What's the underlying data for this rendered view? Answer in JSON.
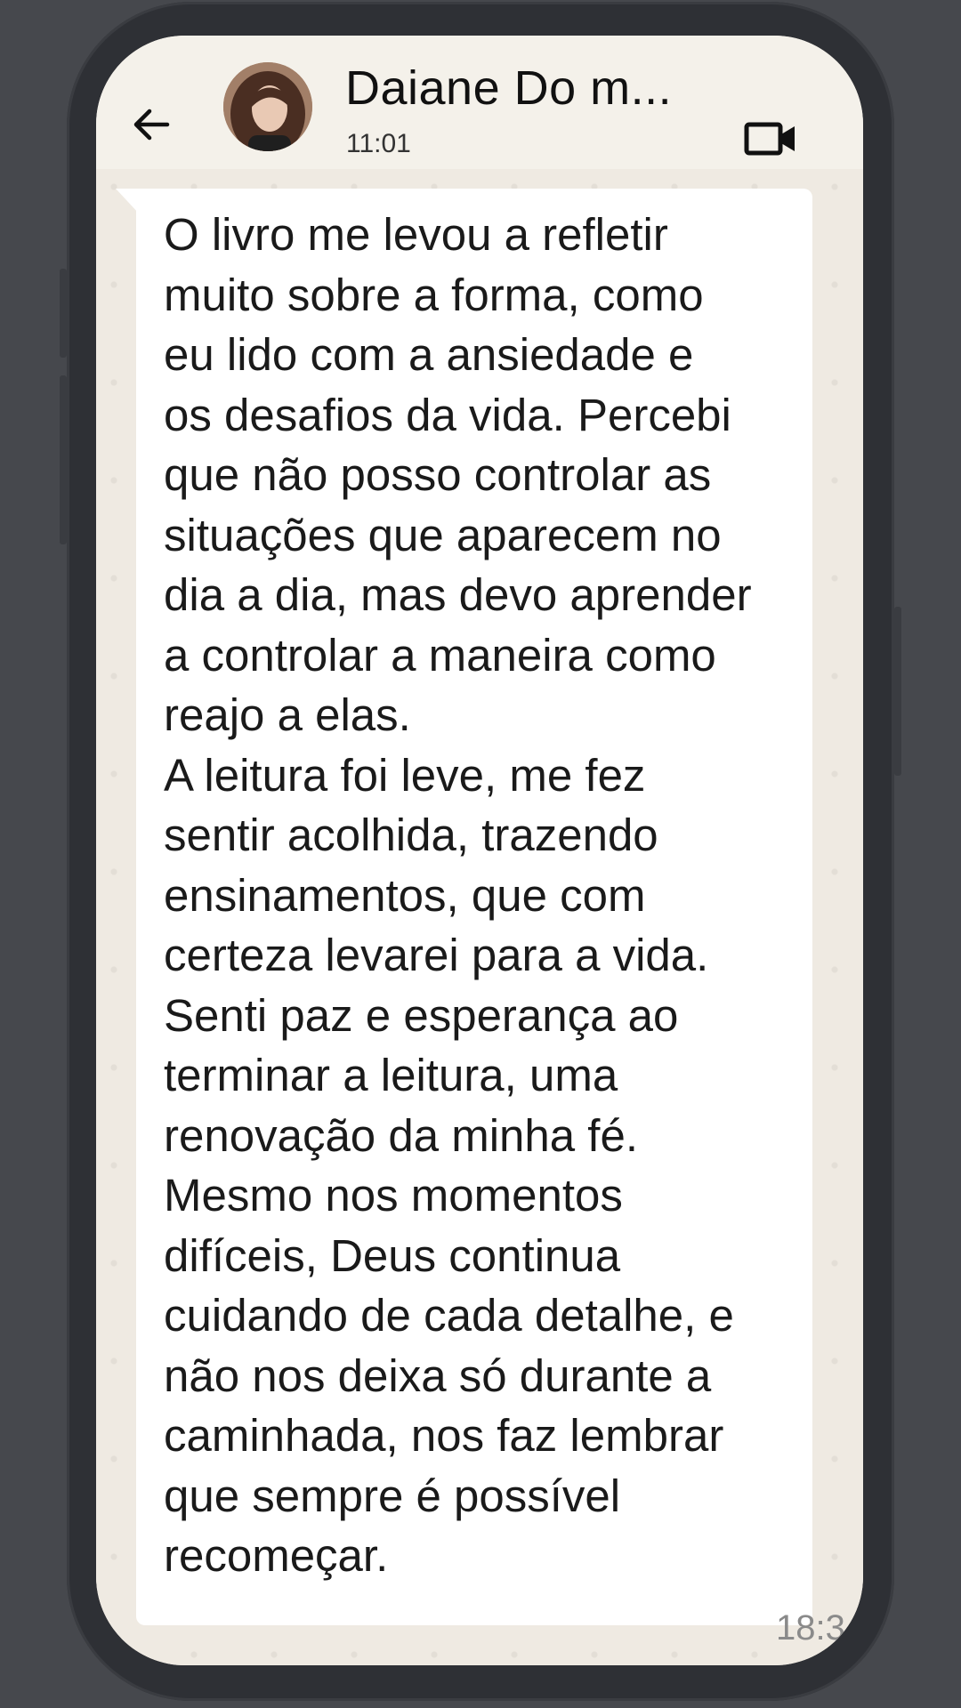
{
  "header": {
    "contact_name": "Daiane Do m...",
    "status_time": "11:01",
    "back_icon": "arrow-left-icon",
    "video_icon": "video-camera-icon"
  },
  "message": {
    "text": "O livro me levou a refletir\nmuito sobre a forma, como\neu lido com a ansiedade e\nos desafios da vida. Percebi\nque não posso controlar as\nsituações que aparecem no\ndia a dia, mas devo aprender\na controlar a maneira como\nreajo a elas.\nA leitura foi leve, me fez\nsentir acolhida, trazendo\nensinamentos, que com\ncerteza levarei para a vida.\nSenti paz e esperança ao\nterminar a leitura, uma\nrenovação da minha fé.\nMesmo nos momentos\ndifíceis, Deus continua\ncuidando de cada detalhe, e\nnão nos deixa só durante a\ncaminhada, nos faz lembrar\nque sempre é possível\nrecomeçar.",
    "time": "18:3"
  },
  "colors": {
    "chat_background": "#efeae2",
    "bubble": "#ffffff",
    "header": "#f4f1ea",
    "device_frame": "#2e3035"
  }
}
